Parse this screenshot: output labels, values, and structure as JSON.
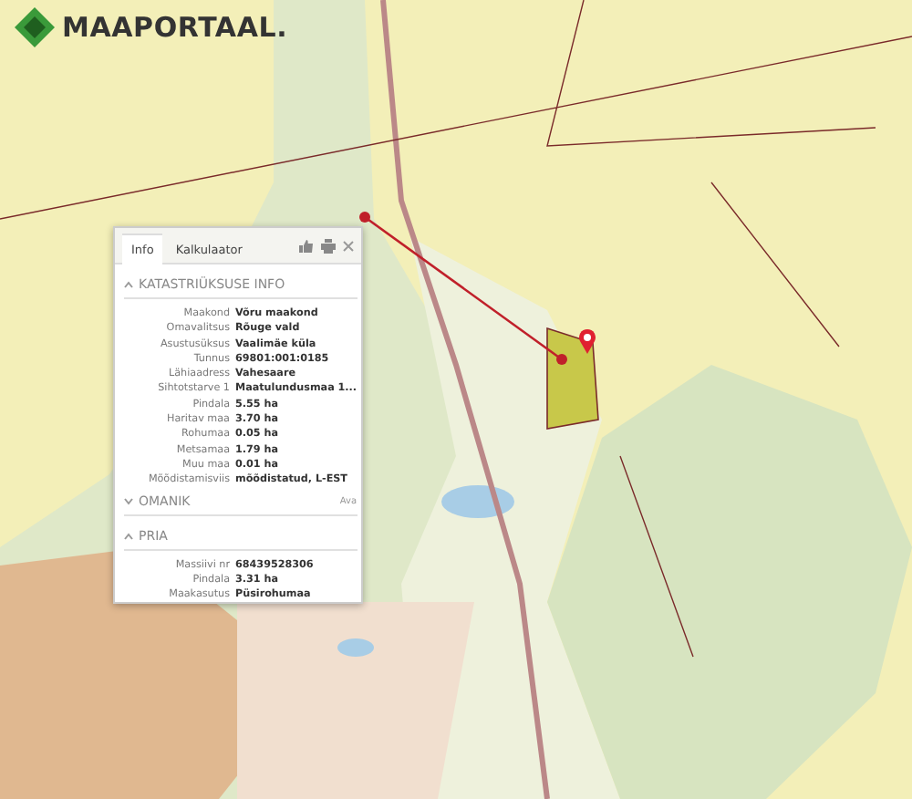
{
  "logo": {
    "text": "MAAPORTAAL."
  },
  "popup": {
    "tabs": [
      {
        "label": "Info",
        "selected": true
      },
      {
        "label": "Kalkulaator",
        "selected": false
      }
    ],
    "sections": [
      {
        "title": "KATASTRIÜKSUSE INFO",
        "expanded": true,
        "rows": [
          {
            "label": "Maakond",
            "value": "Võru maakond"
          },
          {
            "label": "Omavalitsus",
            "value": "Rõuge vald"
          },
          {
            "label": "Asustusüksus",
            "value": "Vaalimäe küla"
          },
          {
            "label": "Tunnus",
            "value": "69801:001:0185"
          },
          {
            "label": "Lähiaadress",
            "value": "Vahesaare"
          },
          {
            "label": "Sihtotstarve 1",
            "value": "Maatulundusmaa 1..."
          },
          {
            "label": "Pindala",
            "value": "5.55 ha"
          },
          {
            "label": "Haritav maa",
            "value": "3.70 ha"
          },
          {
            "label": "Rohumaa",
            "value": "0.05 ha"
          },
          {
            "label": "Metsamaa",
            "value": "1.79 ha"
          },
          {
            "label": "Muu maa",
            "value": "0.01 ha"
          },
          {
            "label": "Mõõdistamisviis",
            "value": "mõõdistatud, L-EST"
          }
        ]
      },
      {
        "title": "OMANIK",
        "expanded": false,
        "action": "Ava"
      },
      {
        "title": "PRIA",
        "expanded": true,
        "rows": [
          {
            "label": "Massiivi nr",
            "value": "68439528306"
          },
          {
            "label": "Pindala",
            "value": "3.31 ha"
          },
          {
            "label": "Maakasutus",
            "value": "Püsirohumaa"
          }
        ]
      }
    ]
  }
}
